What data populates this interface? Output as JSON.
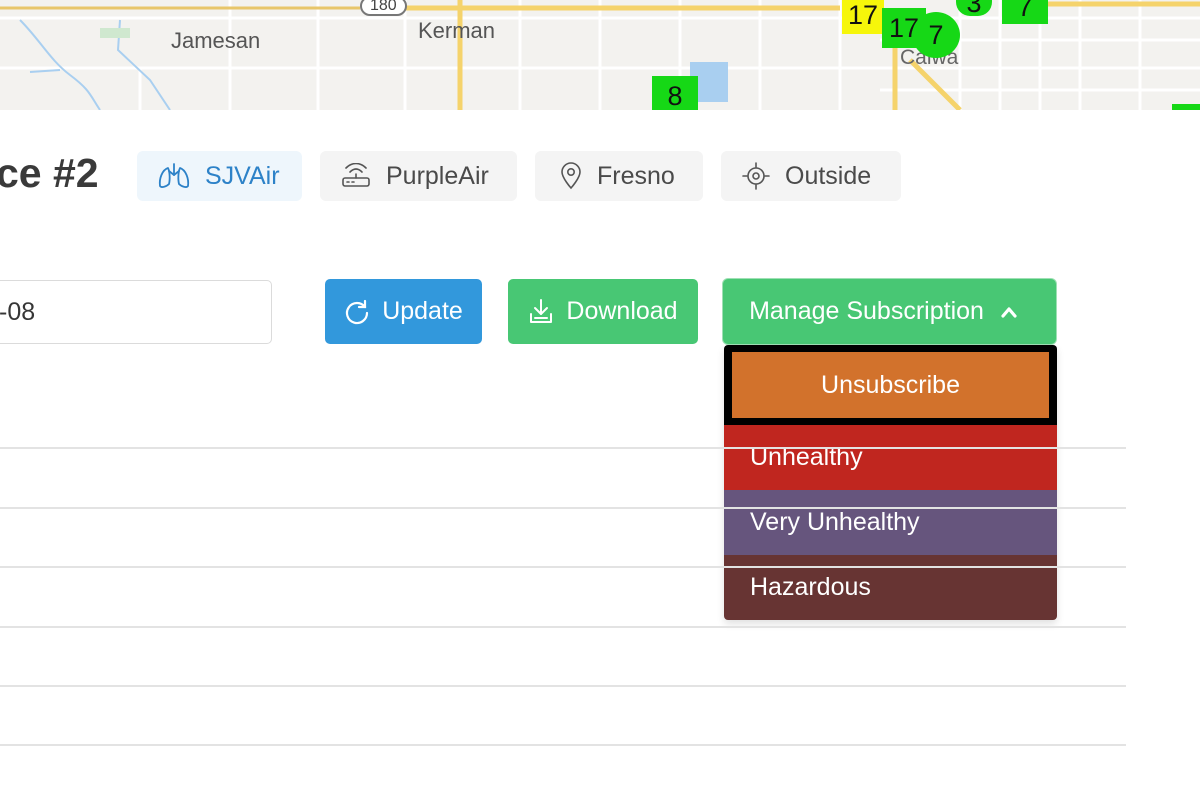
{
  "map": {
    "places": [
      "Jamesan",
      "Kerman",
      "Calwa"
    ],
    "highway": "180",
    "markers": [
      "17",
      "17",
      "7",
      "3",
      "7",
      "8"
    ],
    "colors": {
      "good": "#16d816",
      "moderate": "#f6f60a"
    }
  },
  "device": {
    "title": "ce #2",
    "tags": [
      {
        "label": "SJVAir",
        "icon": "lungs-icon"
      },
      {
        "label": "PurpleAir",
        "icon": "router-icon"
      },
      {
        "label": "Fresno",
        "icon": "map-pin-icon"
      },
      {
        "label": "Outside",
        "icon": "crosshair-icon"
      }
    ]
  },
  "controls": {
    "date_value": "-08",
    "update_label": "Update",
    "download_label": "Download",
    "manage_label": "Manage Subscription"
  },
  "subscription_menu": {
    "items": [
      {
        "label": "Unsubscribe",
        "color": "#d2722c"
      },
      {
        "label": "Unhealthy",
        "color": "#c0261f"
      },
      {
        "label": "Very Unhealthy",
        "color": "#66557d"
      },
      {
        "label": "Hazardous",
        "color": "#673433"
      }
    ]
  },
  "colors": {
    "primary": "#3298dc",
    "success": "#48c774",
    "sjvair_tag_text": "#2d82c8"
  }
}
